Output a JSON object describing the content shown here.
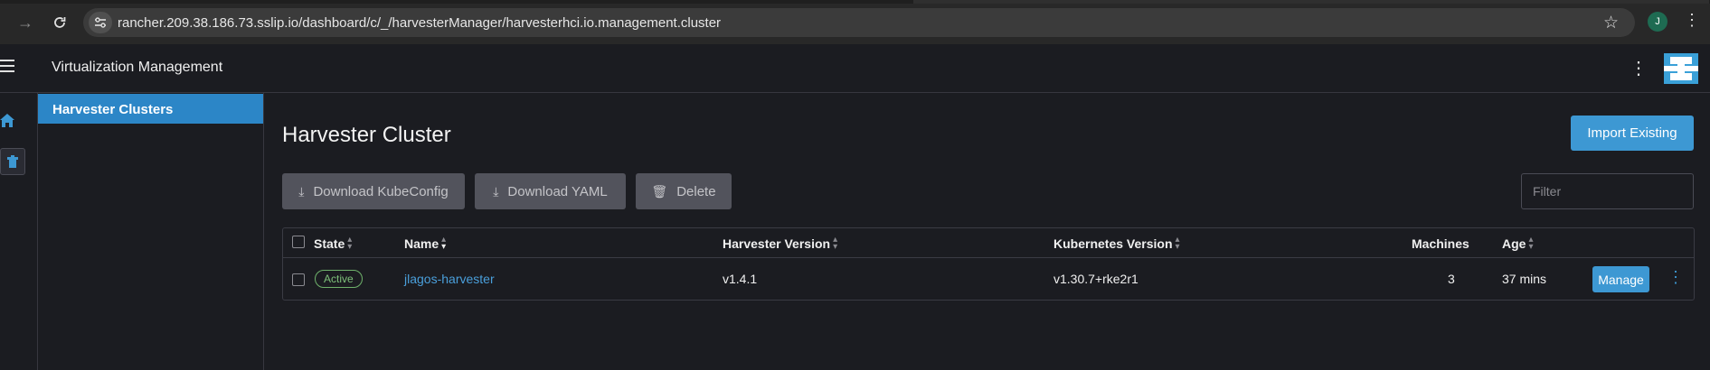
{
  "browser": {
    "url": "rancher.209.38.186.73.sslip.io/dashboard/c/_/harvesterManager/harvesterhci.io.management.cluster",
    "profile_initial": "J",
    "icons": [
      "back-icon",
      "forward-icon",
      "reload-icon",
      "site-info-icon",
      "bookmark-star-icon",
      "browser-menu-icon"
    ]
  },
  "header": {
    "title": "Virtualization Management",
    "icons": [
      "hamburger-menu-icon",
      "kebab-menu-icon",
      "harvester-logo"
    ]
  },
  "rail": {
    "icons": [
      "home-icon",
      "cluster-icon"
    ]
  },
  "sidenav": {
    "items": [
      {
        "label": "Harvester Clusters",
        "active": true
      }
    ]
  },
  "main": {
    "title": "Harvester Cluster",
    "import_button": "Import Existing",
    "bulk_actions": {
      "download_kubeconfig": "Download KubeConfig",
      "download_yaml": "Download YAML",
      "delete": "Delete"
    },
    "filter_placeholder": "Filter"
  },
  "table": {
    "columns": {
      "state": "State",
      "name": "Name",
      "harvester_version": "Harvester Version",
      "kubernetes_version": "Kubernetes Version",
      "machines": "Machines",
      "age": "Age"
    },
    "rows": [
      {
        "state": "Active",
        "name": "jlagos-harvester",
        "harvester_version": "v1.4.1",
        "kubernetes_version": "v1.30.7+rke2r1",
        "machines": "3",
        "age": "37 mins",
        "action": "Manage"
      }
    ]
  },
  "colors": {
    "accent": "#3d98d3",
    "active_nav": "#2c86c7",
    "background": "#1b1c21",
    "active_badge": "#6fb26b",
    "link": "#4a9fdb"
  }
}
